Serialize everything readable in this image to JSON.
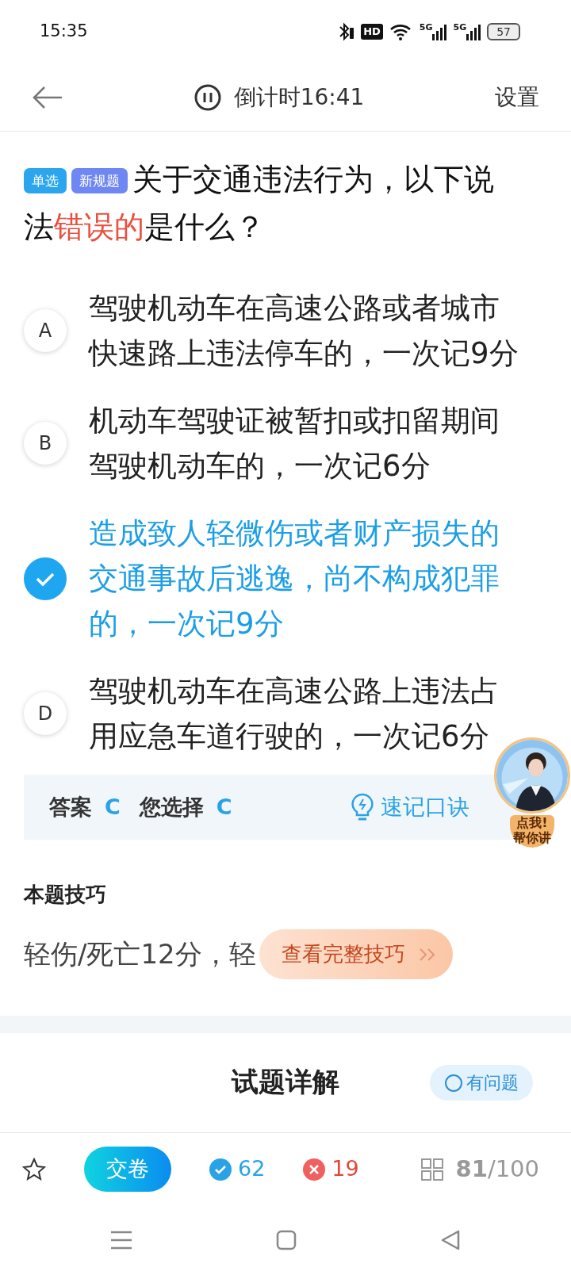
{
  "status_bar": {
    "time": "15:35",
    "hd": "HD",
    "networks": [
      "5G",
      "5G"
    ],
    "battery": "57"
  },
  "header": {
    "countdown": "倒计时16:41",
    "settings": "设置"
  },
  "question": {
    "tags": [
      {
        "label": "单选",
        "color": "#2ba6ee"
      },
      {
        "label": "新规题",
        "color": "#6f87f3"
      }
    ],
    "parts": [
      {
        "text": "关于交通违法行为，以下说法",
        "highlight": false
      },
      {
        "text": "错误的",
        "highlight": true
      },
      {
        "text": "是什么？",
        "highlight": false
      }
    ]
  },
  "options": [
    {
      "letter": "A",
      "text": "驾驶机动车在高速公路或者城市快速路上违法停车的，一次记9分",
      "selected": false
    },
    {
      "letter": "B",
      "text": "机动车驾驶证被暂扣或扣留期间驾驶机动车的，一次记6分",
      "selected": false
    },
    {
      "text": "造成致人轻微伤或者财产损失的交通事故后逃逸，尚不构成犯罪的，一次记9分",
      "selected": true
    },
    {
      "letter": "D",
      "text": "驾驶机动车在高速公路上违法占用应急车道行驶的，一次记6分",
      "selected": false
    }
  ],
  "promo": {
    "line1": "点我!",
    "line2": "帮你讲"
  },
  "answer_bar": {
    "answer_label": "答案",
    "answer": "C",
    "choice_label": "您选择",
    "choice": "C",
    "mnemonic": "速记口诀"
  },
  "tips": {
    "title": "本题技巧",
    "preview": "轻伤/死亡12分，轻",
    "button": "查看完整技巧"
  },
  "detail": {
    "title": "试题详解",
    "help": "有问题"
  },
  "bottom_bar": {
    "submit": "交卷",
    "correct": "62",
    "wrong": "19",
    "progress": "**81**/100"
  }
}
